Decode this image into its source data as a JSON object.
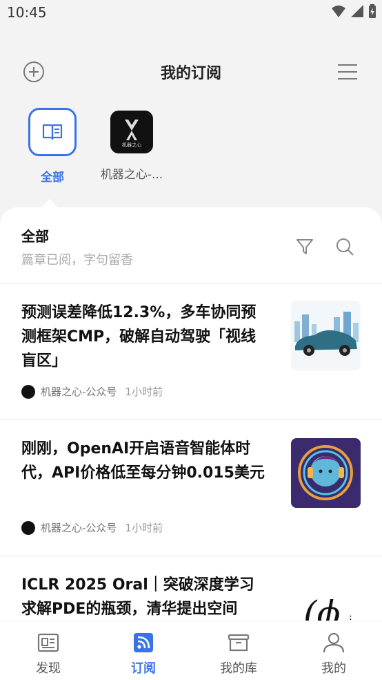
{
  "status_bar": {
    "time": "10:45"
  },
  "header": {
    "title": "我的订阅"
  },
  "subscriptions": [
    {
      "label": "全部",
      "selected": true,
      "icon": "book-icon"
    },
    {
      "label": "机器之心-...",
      "selected": false,
      "icon": "jiqizhixin-logo",
      "logo_text": "机器之心"
    }
  ],
  "feed_header": {
    "title": "全部",
    "subtitle": "篇章已阅，字句留香"
  },
  "articles": [
    {
      "title": "预测误差降低12.3%，多车协同预测框架CMP，破解自动驾驶「视线盲区」",
      "source": "机器之心-公众号",
      "time": "1小时前",
      "thumb": "car-city-image"
    },
    {
      "title": "刚刚，OpenAI开启语音智能体时代，API价格低至每分钟0.015美元",
      "source": "机器之心-公众号",
      "time": "1小时前",
      "thumb": "headphones-avatar-image"
    },
    {
      "title": "ICLR 2025 Oral｜突破深度学习求解PDE的瓶颈，清华提出空间",
      "source": "",
      "time": "",
      "thumb": "phi-symbol-image"
    }
  ],
  "bottom_nav": [
    {
      "label": "发现",
      "active": false
    },
    {
      "label": "订阅",
      "active": true
    },
    {
      "label": "我的库",
      "active": false
    },
    {
      "label": "我的",
      "active": false
    }
  ],
  "colors": {
    "accent": "#3a73e8",
    "background": "#f3f3f3"
  }
}
